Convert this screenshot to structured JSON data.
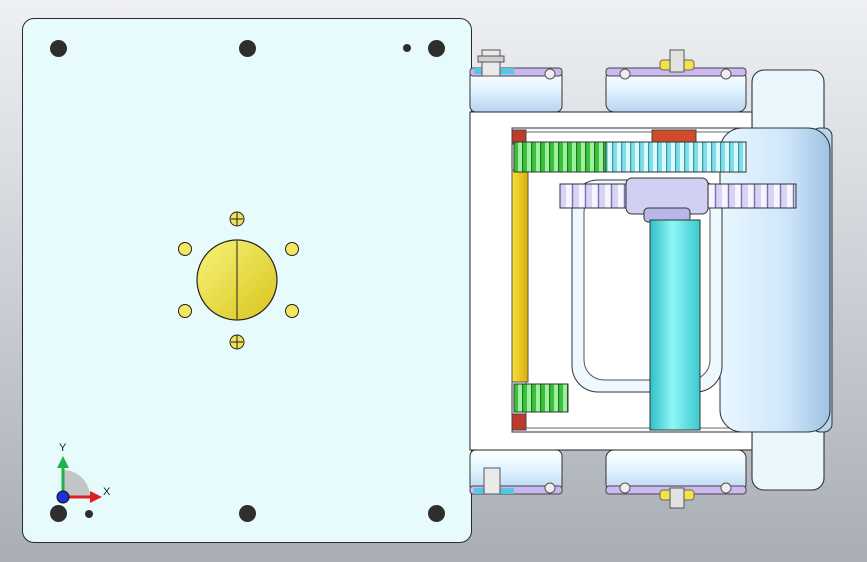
{
  "view": {
    "background_top": "#eef0f3",
    "background_bottom": "#a9aeb6"
  },
  "triad": {
    "y_label": "Y",
    "x_label": "X",
    "y_color": "#21b24b",
    "x_color": "#e02020",
    "z_color": "#1f2fd6"
  },
  "colors": {
    "plate": "#e7fbfc",
    "hub": "#ece24a",
    "spur_gear_green": "#3fc43f",
    "gear_cyan": "#8ee6ee",
    "gear_lavender": "#d7d3f4",
    "shaft": "#57e0e0",
    "yellow_strip": "#f2d21a",
    "red_marker": "#c0392b",
    "frame": "#ffffff"
  }
}
